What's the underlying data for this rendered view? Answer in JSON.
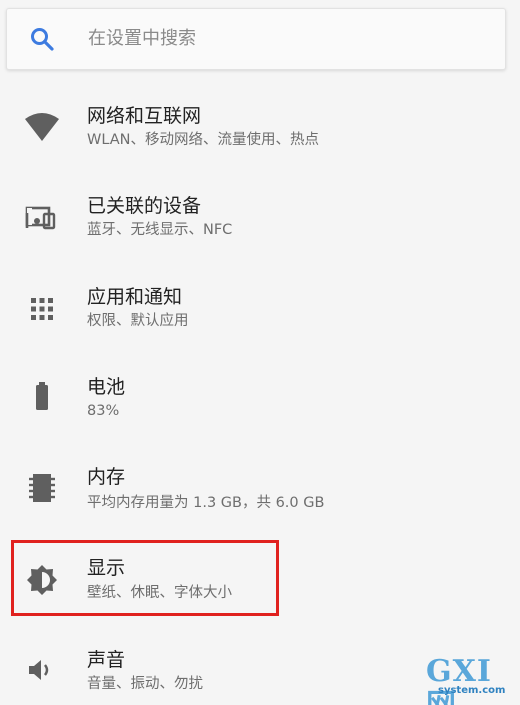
{
  "search": {
    "placeholder": "在设置中搜索",
    "icon": "search-icon",
    "accent": "#3d7be0"
  },
  "settings": [
    {
      "title": "网络和互联网",
      "subtitle": "WLAN、移动网络、流量使用、热点",
      "icon": "wifi-icon"
    },
    {
      "title": "已关联的设备",
      "subtitle": "蓝牙、无线显示、NFC",
      "icon": "connected-devices-icon"
    },
    {
      "title": "应用和通知",
      "subtitle": "权限、默认应用",
      "icon": "apps-grid-icon"
    },
    {
      "title": "电池",
      "subtitle": "83%",
      "icon": "battery-icon"
    },
    {
      "title": "内存",
      "subtitle": "平均内存用量为 1.3 GB，共 6.0 GB",
      "icon": "memory-chip-icon"
    },
    {
      "title": "显示",
      "subtitle": "壁纸、休眠、字体大小",
      "icon": "brightness-icon",
      "highlighted": true
    },
    {
      "title": "声音",
      "subtitle": "音量、振动、勿扰",
      "icon": "volume-icon"
    }
  ],
  "highlight_color": "#e0211f",
  "watermark": {
    "brand": "GXI网",
    "domain": "system.com"
  }
}
